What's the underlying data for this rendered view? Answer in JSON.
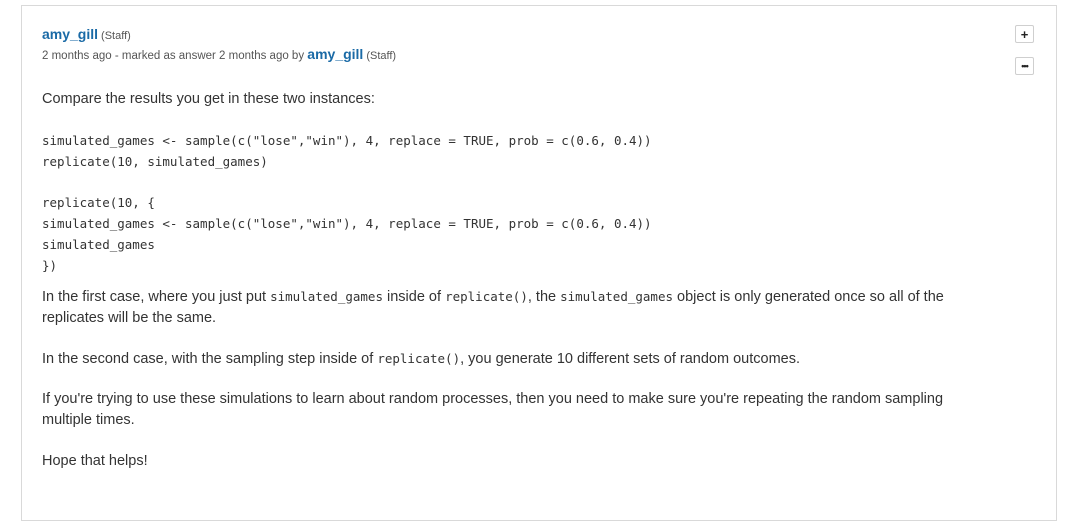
{
  "post": {
    "author": "amy_gill",
    "author_role": "(Staff)",
    "meta_prefix": "2 months ago - marked as answer 2 months ago by",
    "answered_by": "amy_gill",
    "answered_by_role": "(Staff)"
  },
  "actions": {
    "plus_label": "+",
    "more_label": "•••"
  },
  "body": {
    "intro": "Compare the results you get in these two instances:",
    "code1": [
      "simulated_games <- sample(c(\"lose\",\"win\"), 4, replace = TRUE, prob = c(0.6, 0.4))",
      "replicate(10, simulated_games)"
    ],
    "code2": [
      "replicate(10, {",
      "simulated_games <- sample(c(\"lose\",\"win\"), 4, replace = TRUE, prob = c(0.6, 0.4))",
      "simulated_games",
      "})"
    ],
    "first_case": {
      "t1": "In the first case, where you just put ",
      "c1": "simulated_games",
      "t2": " inside of ",
      "c2": "replicate()",
      "t3": ", the ",
      "c3": "simulated_games",
      "t4": " object is only generated once so all of the replicates will be the same."
    },
    "second_case": {
      "t1": "In the second case, with the sampling step inside of ",
      "c1": "replicate()",
      "t2": ", you generate 10 different sets of random outcomes."
    },
    "third": "If you're trying to use these simulations to learn about random processes, then you need to make sure you're repeating the random sampling multiple times.",
    "closing": "Hope that helps!"
  }
}
